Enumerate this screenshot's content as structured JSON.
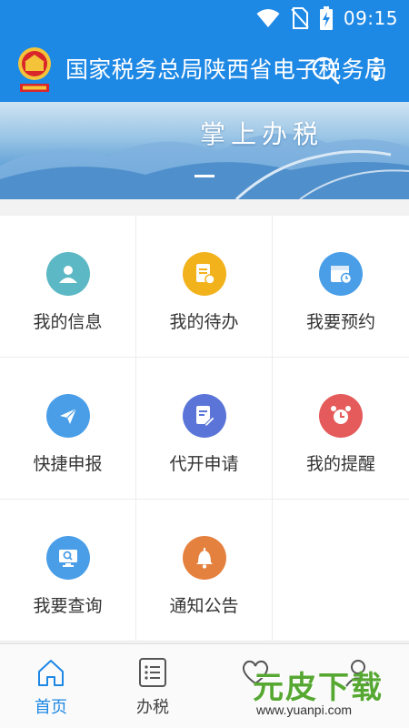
{
  "status_bar": {
    "time": "09:15",
    "icons": [
      "wifi-icon",
      "no-sim-icon",
      "battery-charging-icon"
    ]
  },
  "header": {
    "title": "国家税务总局陕西省电子税务局",
    "emblem_icon": "tax-emblem-icon",
    "actions": [
      "search-icon",
      "more-vertical-icon"
    ]
  },
  "banner": {
    "slogan": "掌上办税"
  },
  "colors": {
    "primary": "#1e88e5",
    "teal": "#5bb8c4",
    "yellow": "#f2b21c",
    "blue": "#4a9ee8",
    "indigo": "#5a74d8",
    "red": "#e55a5a",
    "orange": "#e5813e"
  },
  "grid": [
    {
      "label": "我的信息",
      "icon": "user-icon"
    },
    {
      "label": "我的待办",
      "icon": "todo-doc-icon"
    },
    {
      "label": "我要预约",
      "icon": "calendar-clock-icon"
    },
    {
      "label": "快捷申报",
      "icon": "paper-plane-icon"
    },
    {
      "label": "代开申请",
      "icon": "edit-doc-icon"
    },
    {
      "label": "我的提醒",
      "icon": "alarm-clock-icon"
    },
    {
      "label": "我要查询",
      "icon": "monitor-search-icon"
    },
    {
      "label": "通知公告",
      "icon": "bell-icon"
    }
  ],
  "bottom_nav": [
    {
      "label": "首页",
      "icon": "home-icon",
      "active": true
    },
    {
      "label": "办税",
      "icon": "list-icon",
      "active": false
    },
    {
      "label": "",
      "icon": "heart-icon",
      "active": false
    },
    {
      "label": "",
      "icon": "profile-icon",
      "active": false
    }
  ],
  "watermark": {
    "text": "元皮下载",
    "url": "www.yuanpi.com"
  }
}
